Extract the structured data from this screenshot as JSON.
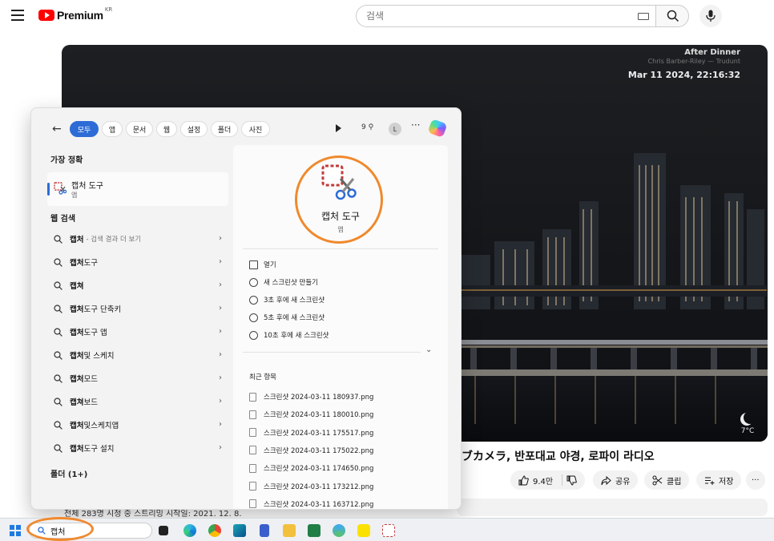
{
  "youtube": {
    "brand": "Premium",
    "region": "KR",
    "search_placeholder": "검색"
  },
  "video": {
    "overlay_title": "After Dinner",
    "overlay_artist": "Chris Barber-Riley — Trudunt",
    "overlay_datetime": "Mar 11 2024, 22:16:32",
    "temperature": "7°C",
    "title": "ブカメラ, 반포대교 야경, 로파이 라디오",
    "description": "전체 283명 시청 중 스트리밍 시작일: 2021. 12. 8."
  },
  "actions": {
    "likes": "9.4만",
    "share": "공유",
    "clip": "클립",
    "save": "저장"
  },
  "start_menu": {
    "filters": [
      "모두",
      "앱",
      "문서",
      "웹",
      "설정",
      "폴더",
      "사진"
    ],
    "points": "9",
    "avatar": "L",
    "more": "···",
    "best_match_title": "가장 정확",
    "best_match": {
      "name": "캡처 도구",
      "kind": "앱"
    },
    "web_title": "웹 검색",
    "web_items": [
      {
        "bold": "캡처",
        "rest": "",
        "sub": "- 검색 결과 더 보기"
      },
      {
        "bold": "캡처",
        "rest": " 도구",
        "sub": ""
      },
      {
        "bold": "캡쳐",
        "rest": "",
        "sub": ""
      },
      {
        "bold": "캡처",
        "rest": "도구 단축키",
        "sub": ""
      },
      {
        "bold": "캡처",
        "rest": "도구 앱",
        "sub": ""
      },
      {
        "bold": "캡처",
        "rest": " 및 스케치",
        "sub": ""
      },
      {
        "bold": "캡처",
        "rest": "모드",
        "sub": ""
      },
      {
        "bold": "캡쳐",
        "rest": "보드",
        "sub": ""
      },
      {
        "bold": "캡처",
        "rest": "및스케치앱",
        "sub": ""
      },
      {
        "bold": "캡처",
        "rest": "도구 설치",
        "sub": ""
      }
    ],
    "folder_title": "폴더 (1+)",
    "detail": {
      "name": "캡처 도구",
      "kind": "앱",
      "actions": [
        "열기",
        "새 스크린샷 만들기",
        "3초 후에 새 스크린샷",
        "5초 후에 새 스크린샷",
        "10초 후에 새 스크린샷"
      ],
      "recent_title": "최근 항목",
      "recent": [
        "스크린샷 2024-03-11 180937.png",
        "스크린샷 2024-03-11 180010.png",
        "스크린샷 2024-03-11 175517.png",
        "스크린샷 2024-03-11 175022.png",
        "스크린샷 2024-03-11 174650.png",
        "스크린샷 2024-03-11 173212.png",
        "스크린샷 2024-03-11 163712.png"
      ]
    }
  },
  "taskbar": {
    "search_value": "캡처"
  },
  "colors": {
    "accent": "#2d6cd6",
    "annotation": "#f0892d",
    "youtube_red": "#ff0000"
  }
}
